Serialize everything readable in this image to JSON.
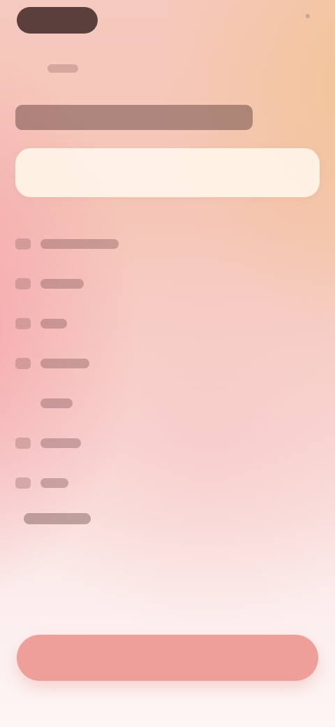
{
  "header": {
    "pill_label": "",
    "right_label": "",
    "sub_label": ""
  },
  "main": {
    "headline": "",
    "search": {
      "value": "",
      "placeholder": ""
    },
    "options": [
      {
        "label": ""
      },
      {
        "label": ""
      },
      {
        "label": ""
      },
      {
        "label": ""
      },
      {
        "label": ""
      },
      {
        "label": ""
      },
      {
        "label": ""
      }
    ],
    "extra_option": ""
  },
  "footer": {
    "cta_label": ""
  },
  "colors": {
    "accent": "#ee9f9a",
    "pill": "#5b3f3c",
    "field": "#fff4e8"
  }
}
